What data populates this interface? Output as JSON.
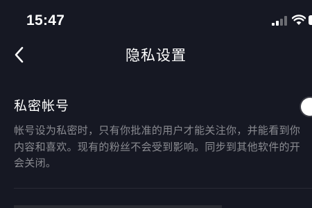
{
  "status_bar": {
    "time": "15:47",
    "icons": [
      "signal-icon",
      "wifi-icon",
      "battery-icon"
    ]
  },
  "nav": {
    "back_icon": "chevron-left-icon",
    "title": "隐私设置"
  },
  "settings": {
    "private_account": {
      "label": "私密帐号",
      "enabled": false,
      "description_lines": [
        "帐号设为私密时，只有你批准的用户才能关注你，并能看到你",
        "内容和喜欢。现有的粉丝不会受到影响。同步到其他软件的开",
        "会关闭。"
      ]
    }
  },
  "colors": {
    "background": "#161823",
    "secondary_text": "#8a8b91",
    "toggle_track_off": "#3a3b44"
  }
}
